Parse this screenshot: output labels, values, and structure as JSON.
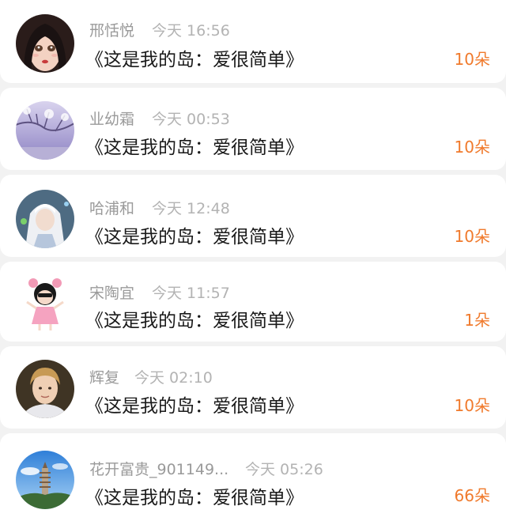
{
  "gift_records": [
    {
      "name": "邢恬悦",
      "time": "今天 16:56",
      "song": "《这是我的岛：爱很简单》",
      "count": "10朵",
      "avatar": "anime-girl-portrait"
    },
    {
      "name": "业幼霜",
      "time": "今天 00:53",
      "song": "《这是我的岛：爱很简单》",
      "count": "10朵",
      "avatar": "purple-winter-tree"
    },
    {
      "name": "哈浦和",
      "time": "今天 12:48",
      "song": "《这是我的岛：爱很简单》",
      "count": "10朵",
      "avatar": "white-haired-anime-character"
    },
    {
      "name": "宋陶宜",
      "time": "今天 11:57",
      "song": "《这是我的岛：爱很简单》",
      "count": "1朵",
      "avatar": "cartoon-girl-pink-dress"
    },
    {
      "name": "辉复",
      "time": "今天 02:10",
      "song": "《这是我的岛：爱很简单》",
      "count": "10朵",
      "avatar": "blond-child-photo"
    },
    {
      "name": "花开富贵_901149...",
      "time": "今天 05:26",
      "song": "《这是我的岛：爱很简单》",
      "count": "66朵",
      "avatar": "pagoda-landscape"
    }
  ],
  "colors": {
    "count": "#f07a2c",
    "name": "#9a9a9a",
    "time": "#b3b3b3",
    "song": "#1a1a1a",
    "background": "#f2f2f2",
    "card": "#ffffff"
  }
}
